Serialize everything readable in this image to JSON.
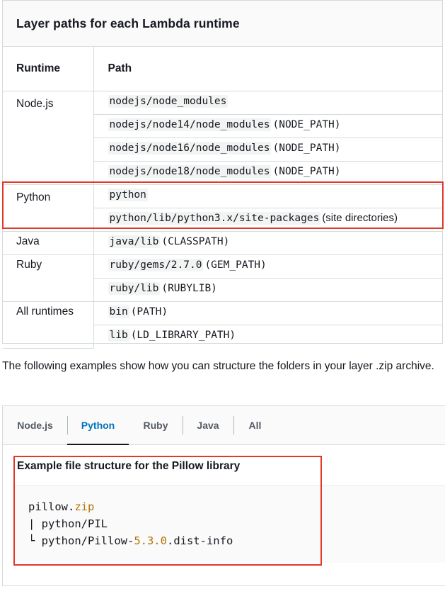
{
  "table": {
    "title": "Layer paths for each Lambda runtime",
    "headers": {
      "runtime": "Runtime",
      "path": "Path"
    },
    "rows": [
      {
        "runtime": "Node.js",
        "paths": [
          {
            "code": "nodejs/node_modules",
            "note": ""
          },
          {
            "code": "nodejs/node14/node_modules",
            "note": "(NODE_PATH)"
          },
          {
            "code": "nodejs/node16/node_modules",
            "note": "(NODE_PATH)"
          },
          {
            "code": "nodejs/node18/node_modules",
            "note": "(NODE_PATH)"
          }
        ]
      },
      {
        "runtime": "Python",
        "paths": [
          {
            "code": "python",
            "note": ""
          },
          {
            "code": "python/lib/python3.x/site-packages",
            "note": "(site directories)"
          }
        ]
      },
      {
        "runtime": "Java",
        "paths": [
          {
            "code": "java/lib",
            "note": "(CLASSPATH)"
          }
        ]
      },
      {
        "runtime": "Ruby",
        "paths": [
          {
            "code": "ruby/gems/2.7.0",
            "note": "(GEM_PATH)"
          },
          {
            "code": "ruby/lib",
            "note": "(RUBYLIB)"
          }
        ]
      },
      {
        "runtime": "All runtimes",
        "paths": [
          {
            "code": "bin",
            "note": "(PATH)"
          },
          {
            "code": "lib",
            "note": "(LD_LIBRARY_PATH)"
          }
        ]
      }
    ]
  },
  "intro": "The following examples show how you can structure the folders in your layer .zip archive.",
  "tabs": {
    "items": [
      "Node.js",
      "Python",
      "Ruby",
      "Java",
      "All"
    ],
    "active": "Python"
  },
  "example": {
    "title": "Example file structure for the Pillow library",
    "code": {
      "line1_prefix": "pillow.",
      "line1_accent": "zip",
      "line2": "| python/PIL",
      "line3_prefix": "└ python/Pillow-",
      "line3_accent": "5.3.0",
      "line3_suffix": ".dist-info"
    }
  },
  "colors": {
    "highlight": "#e2382a",
    "active_tab": "#0073bb",
    "code_accent": "#b47302"
  }
}
